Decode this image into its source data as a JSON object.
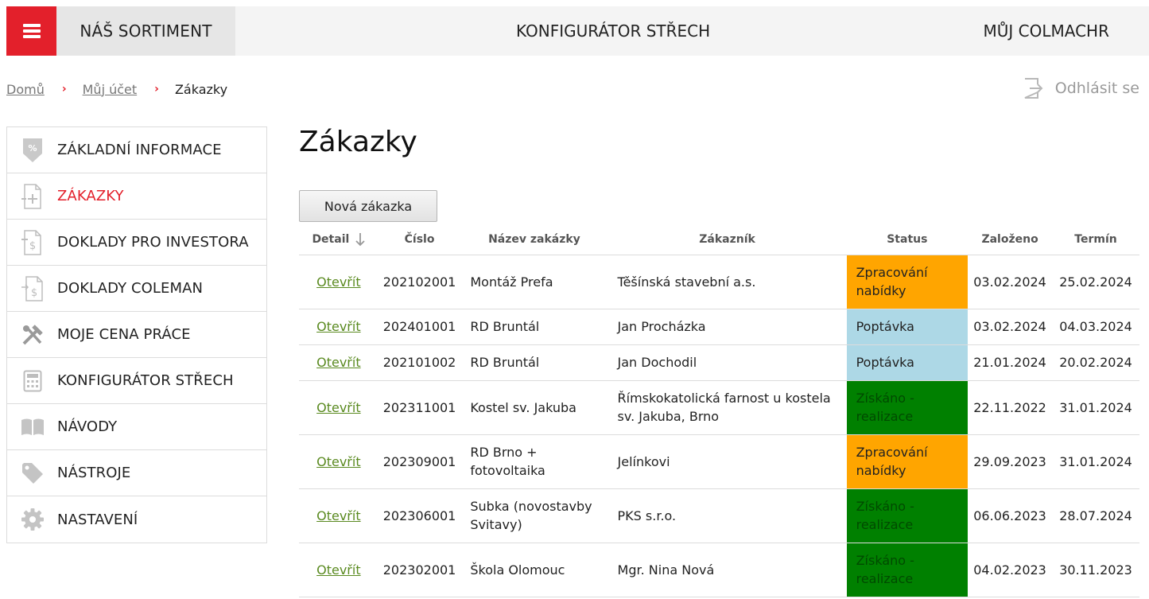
{
  "topbar": {
    "sortiment": "NÁŠ SORTIMENT",
    "konfigurator": "KONFIGURÁTOR STŘECH",
    "muj_colmachr": "MŮJ COLMACHR"
  },
  "breadcrumb": {
    "home": "Domů",
    "account": "Můj účet",
    "current": "Zákazky",
    "separator": "›"
  },
  "logout_label": "Odhlásit se",
  "sidebar": {
    "items": [
      {
        "label": "ZÁKLADNÍ INFORMACE",
        "icon": "percent-tag-icon"
      },
      {
        "label": "ZÁKAZKY",
        "icon": "document-plus-icon",
        "active": true
      },
      {
        "label": "DOKLADY PRO INVESTORA",
        "icon": "document-dollar-icon"
      },
      {
        "label": "DOKLADY COLEMAN",
        "icon": "document-dollar-arrow-icon"
      },
      {
        "label": "MOJE CENA PRÁCE",
        "icon": "tools-icon"
      },
      {
        "label": "KONFIGURÁTOR STŘECH",
        "icon": "calculator-icon"
      },
      {
        "label": "NÁVODY",
        "icon": "book-icon"
      },
      {
        "label": "NÁSTROJE",
        "icon": "tag-icon"
      },
      {
        "label": "NASTAVENÍ",
        "icon": "gear-icon"
      }
    ]
  },
  "main": {
    "title": "Zákazky",
    "new_button": "Nová zákazka",
    "columns": [
      "Detail",
      "Číslo",
      "Název zakázky",
      "Zákazník",
      "Status",
      "Založeno",
      "Termín"
    ],
    "rows": [
      {
        "detail": "Otevřít",
        "number": "202102001",
        "name": "Montáž Prefa",
        "customer": "Těšínská stavební a.s.",
        "status": "Zpracování nabídky",
        "status_color": "#ffa500",
        "created": "03.02.2024",
        "deadline": "25.02.2024"
      },
      {
        "detail": "Otevřít",
        "number": "202401001",
        "name": "RD Bruntál",
        "customer": "Jan Procházka",
        "status": "Poptávka",
        "status_color": "#add8e6",
        "created": "03.02.2024",
        "deadline": "04.03.2024"
      },
      {
        "detail": "Otevřít",
        "number": "202101002",
        "name": "RD Bruntál",
        "customer": "Jan Dochodil",
        "status": "Poptávka",
        "status_color": "#add8e6",
        "created": "21.01.2024",
        "deadline": "20.02.2024"
      },
      {
        "detail": "Otevřít",
        "number": "202311001",
        "name": "Kostel sv. Jakuba",
        "customer": "Římskokatolická farnost u kostela sv. Jakuba, Brno",
        "status": "Získáno - realizace",
        "status_color": "#008000",
        "created": "22.11.2022",
        "deadline": "31.01.2024"
      },
      {
        "detail": "Otevřít",
        "number": "202309001",
        "name": "RD Brno + fotovoltaika",
        "customer": "Jelínkovi",
        "status": "Zpracování nabídky",
        "status_color": "#ffa500",
        "created": "29.09.2023",
        "deadline": "31.01.2024"
      },
      {
        "detail": "Otevřít",
        "number": "202306001",
        "name": "Subka (novostavby Svitavy)",
        "customer": "PKS s.r.o.",
        "status": "Získáno - realizace",
        "status_color": "#008000",
        "created": "06.06.2023",
        "deadline": "28.07.2024"
      },
      {
        "detail": "Otevřít",
        "number": "202302001",
        "name": "Škola Olomouc",
        "customer": "Mgr. Nina Nová",
        "status": "Získáno - realizace",
        "status_color": "#008000",
        "created": "04.02.2023",
        "deadline": "30.11.2023"
      }
    ]
  },
  "colors": {
    "accent": "#e3202b",
    "link": "#5a8a20"
  }
}
